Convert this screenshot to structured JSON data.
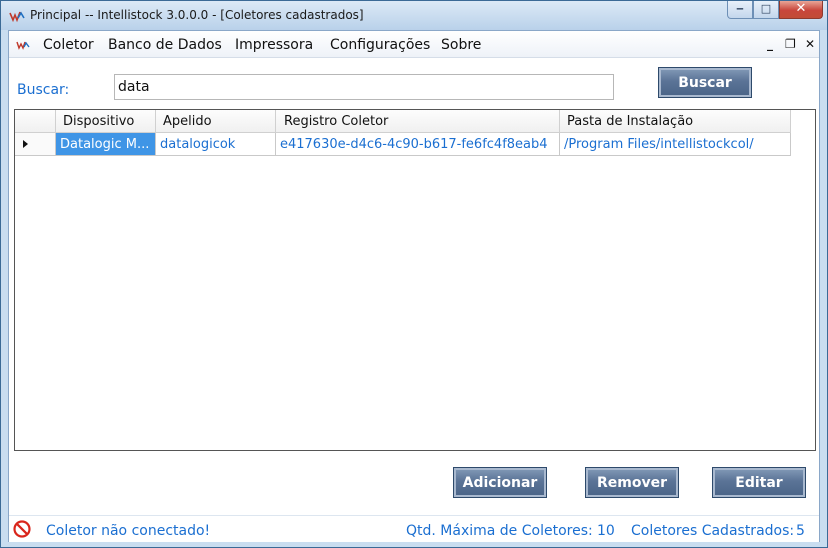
{
  "window": {
    "title": "Principal -- Intellistock 3.0.0.0 - [Coletores cadastrados]",
    "minimize_glyph": "‒",
    "maximize_glyph": "□",
    "close_glyph": "✕",
    "app_icon": "intellistock-logo-icon"
  },
  "menu": {
    "items": [
      "Coletor",
      "Banco de Dados",
      "Impressora",
      "Configurações",
      "Sobre"
    ],
    "mdi_minimize": "_",
    "mdi_restore": "❐",
    "mdi_close": "✕"
  },
  "search": {
    "label": "Buscar:",
    "value": "data",
    "button_label": "Buscar"
  },
  "grid": {
    "columns": [
      "Dispositivo",
      "Apelido",
      "Registro Coletor",
      "Pasta de Instalação"
    ],
    "rows": [
      [
        "Datalogic M...",
        "datalogicok",
        "e417630e-d4c6-4c90-b617-fe6fc4f8eab4",
        "/Program Files/intellistockcol/"
      ]
    ]
  },
  "actions": {
    "add": "Adicionar",
    "remove": "Remover",
    "edit": "Editar"
  },
  "status": {
    "connection": "Coletor não conectado!",
    "max_label": "Qtd. Máxima de Coletores:",
    "max_value": "10",
    "registered_label": "Coletores Cadastrados:",
    "registered_value": "5",
    "icon": "no-entry-icon"
  },
  "colors": {
    "accent_text": "#1b6fd1",
    "selection": "#3f95e6",
    "button": "#5a7396",
    "close_button": "#c8463b",
    "status_icon": "#d9261c"
  }
}
